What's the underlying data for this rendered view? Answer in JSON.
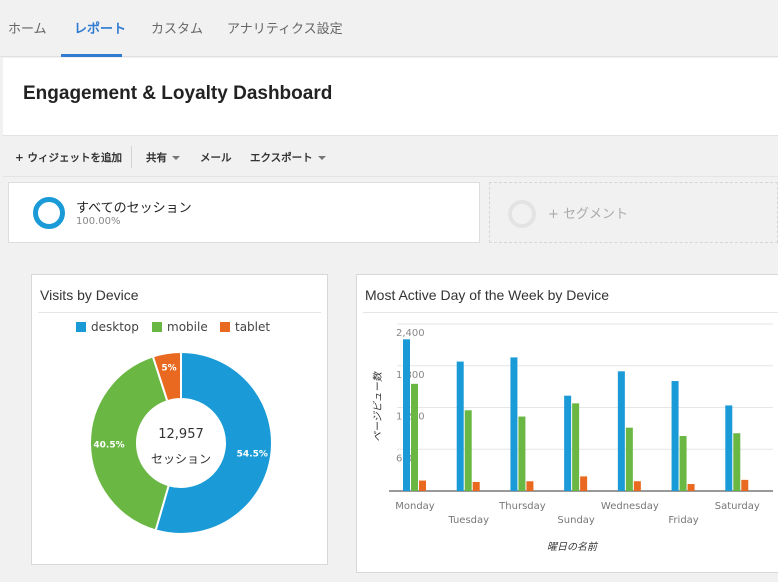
{
  "nav": {
    "tabs": [
      {
        "label": "ホーム"
      },
      {
        "label": "レポート"
      },
      {
        "label": "カスタム"
      },
      {
        "label": "アナリティクス設定"
      }
    ]
  },
  "page": {
    "title": "Engagement & Loyalty Dashboard"
  },
  "toolbar": {
    "add_widget": "+ ウィジェットを追加",
    "share": "共有",
    "email": "メール",
    "export": "エクスポート"
  },
  "segment": {
    "name": "すべてのセッション",
    "percent": "100.00%",
    "add_label": "+ セグメント"
  },
  "colors": {
    "desktop": "#1a9bd7",
    "mobile": "#6ab744",
    "tablet": "#e8691f",
    "accent": "#2f7bd1"
  },
  "widgets": {
    "visits": {
      "title": "Visits by Device",
      "center_value": "12,957",
      "center_label": "セッション"
    },
    "weekday": {
      "title": "Most Active Day of the Week by Device"
    }
  },
  "chart_data": [
    {
      "type": "pie",
      "title": "Visits by Device",
      "legend": "top",
      "total": 12957,
      "slices": [
        {
          "label": "desktop",
          "value": 54.5,
          "text": "54.5%"
        },
        {
          "label": "mobile",
          "value": 40.5,
          "text": "40.5%"
        },
        {
          "label": "tablet",
          "value": 5,
          "text": "5%"
        }
      ]
    },
    {
      "type": "bar",
      "title": "Most Active Day of the Week by Device",
      "xlabel": "曜日の名前",
      "ylabel": "ページビュー数",
      "ylim": [
        0,
        2400
      ],
      "yticks": [
        "2,400",
        "1,800",
        "1,200",
        "600"
      ],
      "grid": true,
      "categories": [
        "Monday",
        "Tuesday",
        "Thursday",
        "Sunday",
        "Wednesday",
        "Friday",
        "Saturday"
      ],
      "series": [
        {
          "name": "desktop",
          "values": [
            2180,
            1860,
            1920,
            1370,
            1720,
            1580,
            1230
          ]
        },
        {
          "name": "mobile",
          "values": [
            1540,
            1160,
            1070,
            1260,
            910,
            790,
            830
          ]
        },
        {
          "name": "tablet",
          "values": [
            150,
            130,
            140,
            210,
            140,
            100,
            160
          ]
        }
      ]
    }
  ]
}
